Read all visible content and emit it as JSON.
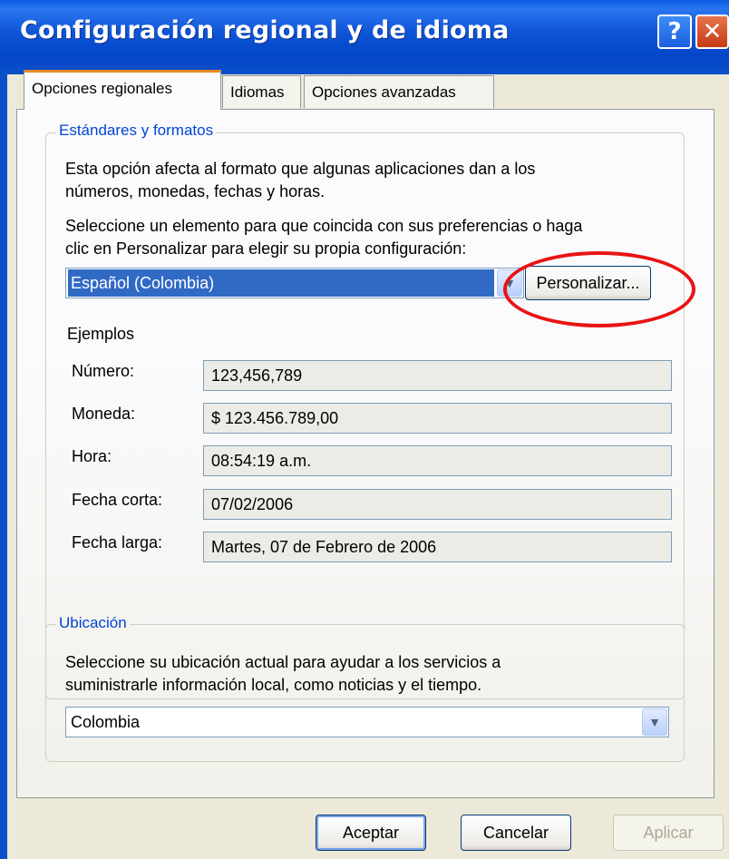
{
  "window": {
    "title": "Configuración regional y de idioma",
    "help_glyph": "?",
    "close_glyph": "✕"
  },
  "tabs": [
    {
      "label": "Opciones regionales",
      "active": true
    },
    {
      "label": "Idiomas",
      "active": false
    },
    {
      "label": "Opciones avanzadas",
      "active": false
    }
  ],
  "standards": {
    "legend": "Estándares y formatos",
    "description_line1": "Esta opción afecta al formato que algunas aplicaciones dan a los",
    "description_line2": "números, monedas, fechas y horas.",
    "select_prompt_line1": "Seleccione un elemento para que coincida con sus preferencias o haga",
    "select_prompt_line2": "clic en Personalizar para elegir su propia configuración:",
    "selected_locale": "Español (Colombia)",
    "customize_button": "Personalizar...",
    "examples_heading": "Ejemplos",
    "examples": [
      {
        "label": "Número:",
        "value": "123,456,789"
      },
      {
        "label": "Moneda:",
        "value": "$ 123.456.789,00"
      },
      {
        "label": "Hora:",
        "value": "08:54:19 a.m."
      },
      {
        "label": "Fecha corta:",
        "value": "07/02/2006"
      },
      {
        "label": "Fecha larga:",
        "value": "Martes, 07 de Febrero de 2006"
      }
    ]
  },
  "location": {
    "legend": "Ubicación",
    "description_line1": "Seleccione su ubicación actual para ayudar a los servicios a",
    "description_line2": "suministrarle información local, como noticias y el tiempo.",
    "selected": "Colombia"
  },
  "footer": {
    "ok": "Aceptar",
    "cancel": "Cancelar",
    "apply": "Aplicar"
  },
  "colors": {
    "titlebar": "#0a4fc9",
    "group_legend": "#0046d5",
    "highlight_ellipse": "#e81313",
    "selection": "#316ac5"
  }
}
